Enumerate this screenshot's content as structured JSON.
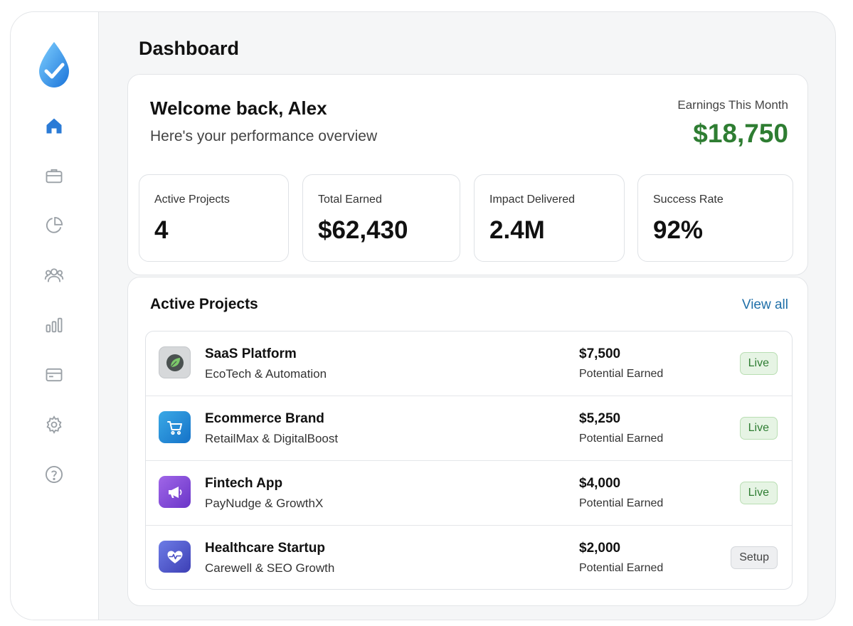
{
  "header": {
    "title": "Dashboard"
  },
  "sidebar": {
    "logo": "water-drop-check-logo",
    "items": [
      {
        "icon": "home-icon",
        "active": true
      },
      {
        "icon": "briefcase-icon",
        "active": false
      },
      {
        "icon": "pie-chart-icon",
        "active": false
      },
      {
        "icon": "users-icon",
        "active": false
      },
      {
        "icon": "bar-chart-icon",
        "active": false
      },
      {
        "icon": "card-icon",
        "active": false
      },
      {
        "icon": "gear-icon",
        "active": false
      },
      {
        "icon": "help-icon",
        "active": false
      }
    ]
  },
  "overview": {
    "welcome": "Welcome back, Alex",
    "subtitle": "Here's your performance overview",
    "earnings_label": "Earnings This Month",
    "earnings_value": "$18,750",
    "stats": [
      {
        "label": "Active Projects",
        "value": "4"
      },
      {
        "label": "Total Earned",
        "value": "$62,430"
      },
      {
        "label": "Impact Delivered",
        "value": "2.4M"
      },
      {
        "label": "Success Rate",
        "value": "92%"
      }
    ]
  },
  "projects": {
    "title": "Active Projects",
    "view_all": "View all",
    "rows": [
      {
        "name": "SaaS Platform",
        "partners": "EcoTech & Automation",
        "amount": "$7,500",
        "sub": "Potential Earned",
        "status": "Live",
        "icon": "leaf-icon"
      },
      {
        "name": "Ecommerce Brand",
        "partners": "RetailMax & DigitalBoost",
        "amount": "$5,250",
        "sub": "Potential Earned",
        "status": "Live",
        "icon": "cart-icon"
      },
      {
        "name": "Fintech App",
        "partners": "PayNudge & GrowthX",
        "amount": "$4,000",
        "sub": "Potential Earned",
        "status": "Live",
        "icon": "megaphone-icon"
      },
      {
        "name": "Healthcare Startup",
        "partners": "Carewell & SEO Growth",
        "amount": "$2,000",
        "sub": "Potential Earned",
        "status": "Setup",
        "icon": "heart-pulse-icon"
      }
    ]
  },
  "colors": {
    "accent": "#1f6fa8",
    "success": "#2e7d32",
    "nav_active": "#2b7bd6",
    "nav_inactive": "#9aa0a6"
  }
}
